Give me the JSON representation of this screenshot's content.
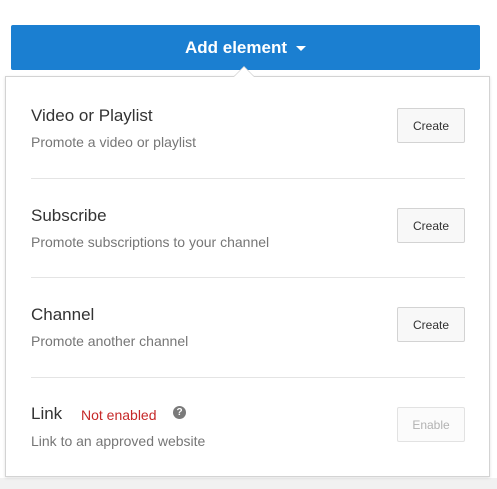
{
  "header": {
    "add_button_label": "Add element"
  },
  "items": [
    {
      "title": "Video or Playlist",
      "description": "Promote a video or playlist",
      "action_label": "Create"
    },
    {
      "title": "Subscribe",
      "description": "Promote subscriptions to your channel",
      "action_label": "Create"
    },
    {
      "title": "Channel",
      "description": "Promote another channel",
      "action_label": "Create"
    },
    {
      "title": "Link",
      "status": "Not enabled",
      "help_icon": "?",
      "description": "Link to an approved website",
      "action_label": "Enable"
    }
  ],
  "colors": {
    "accent": "#1b7fd1",
    "status_error": "#c62828"
  }
}
